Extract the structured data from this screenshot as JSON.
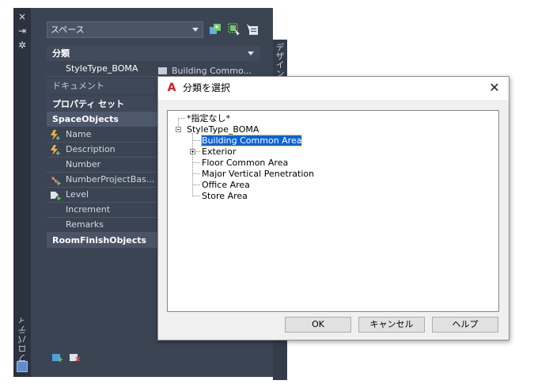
{
  "palette": {
    "rail_close": "×",
    "rail_pin": "⇥",
    "rail_settings": "✲",
    "vertical_label": "プロパティ",
    "design_tab": "デザイン",
    "style_select": "スペース",
    "sections": {
      "classification_header": "分類",
      "classification_label": "StyleType_BOMA",
      "classification_value": "Building Commo...",
      "document": "ドキュメント",
      "property_sets": "プロパティ セット",
      "space_objects": "SpaceObjects",
      "room_finish_objects": "RoomFinishObjects"
    },
    "properties": [
      {
        "label": "Name",
        "icon": "lightning-add-icon"
      },
      {
        "label": "Description",
        "icon": "lightning-add-icon"
      },
      {
        "label": "Number",
        "icon": ""
      },
      {
        "label": "NumberProjectBas...",
        "icon": "tree-add-icon"
      },
      {
        "label": "Level",
        "icon": "level-add-icon"
      },
      {
        "label": "Increment",
        "icon": ""
      },
      {
        "label": "Remarks",
        "icon": ""
      }
    ],
    "accent_color": "#3b4453"
  },
  "dialog": {
    "title": "分類を選択",
    "close": "✕",
    "tree": {
      "none": "*指定なし*",
      "root": "StyleType_BOMA",
      "children": [
        "Building Common Area",
        "Exterior",
        "Floor Common Area",
        "Major Vertical Penetration",
        "Office Area",
        "Store Area"
      ],
      "selected": "Building Common Area"
    },
    "buttons": {
      "ok": "OK",
      "cancel": "キャンセル",
      "help": "ヘルプ"
    }
  }
}
